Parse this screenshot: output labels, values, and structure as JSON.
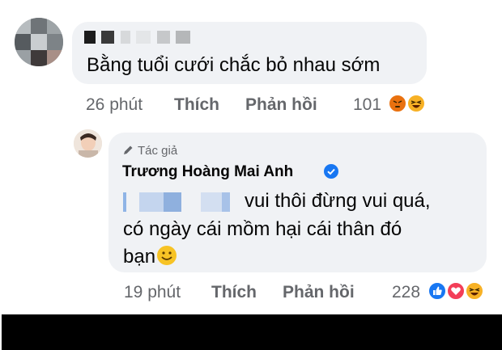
{
  "comment1": {
    "text": "Bằng tuổi cưới chắc bỏ nhau sớm",
    "time": "26 phút",
    "like_label": "Thích",
    "reply_label": "Phản hồi",
    "reaction_count": "101",
    "reactions": [
      "angry-reaction-icon",
      "haha-reaction-icon"
    ]
  },
  "reply": {
    "badge_label": "Tác giả",
    "author": "Trương Hoàng Mai Anh",
    "line1": "vui thôi đừng vui quá,",
    "line2": "có ngày cái mồm hại cái thân đó",
    "line3": "bạn",
    "time": "19 phút",
    "like_label": "Thích",
    "reply_label": "Phản hồi",
    "reaction_count": "228",
    "reactions": [
      "like-reaction-icon",
      "love-reaction-icon",
      "haha-reaction-icon"
    ]
  },
  "colors": {
    "bubble": "#f0f2f5",
    "secondary_text": "#65676b",
    "verified_blue": "#1877f2",
    "like_blue": "#1877f2",
    "love_red": "#f33e58",
    "emoji_yellow": "#f7b125"
  }
}
